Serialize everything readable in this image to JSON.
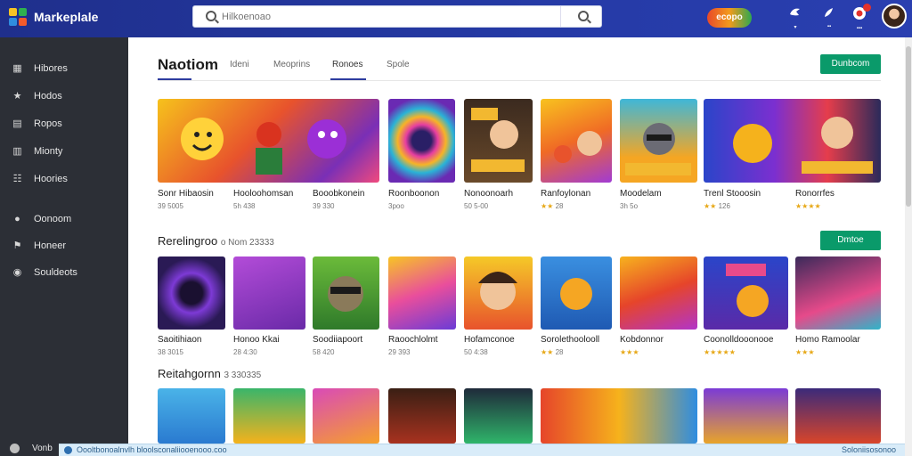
{
  "app": {
    "brand": "Markeplale"
  },
  "search": {
    "placeholder": "Hilkoenoao"
  },
  "topbar": {
    "promo_label": "ecopo",
    "icons": [
      "app-icon",
      "rocket-icon",
      "gift-icon"
    ]
  },
  "sidebar": {
    "items": [
      {
        "label": "Hibores",
        "icon": "library-icon"
      },
      {
        "label": "Hodos",
        "icon": "star-icon"
      },
      {
        "label": "Ropos",
        "icon": "cart-icon"
      },
      {
        "label": "Mionty",
        "icon": "book-icon"
      },
      {
        "label": "Hoories",
        "icon": "people-icon"
      },
      {
        "label": "Oonoom",
        "icon": "chat-icon"
      },
      {
        "label": "Honeer",
        "icon": "flag-icon"
      },
      {
        "label": "Souldeots",
        "icon": "info-icon"
      }
    ],
    "footer_label": "Vonb"
  },
  "tabs": {
    "title": "Naotiom",
    "items": [
      "Ideni",
      "Meoprins",
      "Ronoes",
      "Spole"
    ],
    "active_index": 2
  },
  "section1": {
    "button": "Dunbcom",
    "cards": [
      {
        "title": "Sonr Hibaosin",
        "meta": "39 5005",
        "stars": ""
      },
      {
        "title": "Hooloohomsan",
        "meta": "5h 438",
        "stars": ""
      },
      {
        "title": "Booobkonein",
        "meta": "39 330",
        "stars": ""
      },
      {
        "title": "Roonboonon",
        "meta": "3poo",
        "stars": ""
      },
      {
        "title": "Nonoonoarh",
        "meta": "50 5-00",
        "stars": ""
      },
      {
        "title": "Ranfoylonan",
        "meta": "28",
        "stars": "★★"
      },
      {
        "title": "Moodelam",
        "meta": "3h 5o",
        "stars": ""
      },
      {
        "title": "Trenl Stooosin",
        "meta": "126",
        "stars": "★★"
      },
      {
        "title": "Ronorrfes",
        "meta": "",
        "stars": "★★★★"
      }
    ]
  },
  "section2": {
    "title": "Rerelingroo",
    "count": "o Nom 23333",
    "button": "Dmtoe",
    "cards": [
      {
        "title": "Saoitihiaon",
        "meta": "38 3015",
        "stars": ""
      },
      {
        "title": "Honoo Kkai",
        "meta": "28 4:30",
        "stars": ""
      },
      {
        "title": "Soodiiapoort",
        "meta": "58 420",
        "stars": ""
      },
      {
        "title": "Raoochlolmt",
        "meta": "29 393",
        "stars": ""
      },
      {
        "title": "Hofamconoe",
        "meta": "50 4:38",
        "stars": ""
      },
      {
        "title": "Sorolethoolooll",
        "meta": "28",
        "stars": "★★"
      },
      {
        "title": "Kobdonnor",
        "meta": "",
        "stars": "★★★"
      },
      {
        "title": "Coonolldooonooe",
        "meta": "",
        "stars": "★★★★★"
      },
      {
        "title": "Homo Ramoolar",
        "meta": "",
        "stars": "★★★"
      }
    ]
  },
  "section3": {
    "title": "Reitahgornn",
    "count": "3 330335"
  },
  "statusbar": {
    "text": "Oooltbonoalnvlh bloolsconaliiooenooo.coo",
    "right": "Soloniisosonoo"
  },
  "colors": {
    "topbar": "#253aa6",
    "sidebar": "#2c2f36",
    "accent_button": "#0a9a6a",
    "tab_underline": "#2d3c9f",
    "stars": "#e7a817"
  }
}
